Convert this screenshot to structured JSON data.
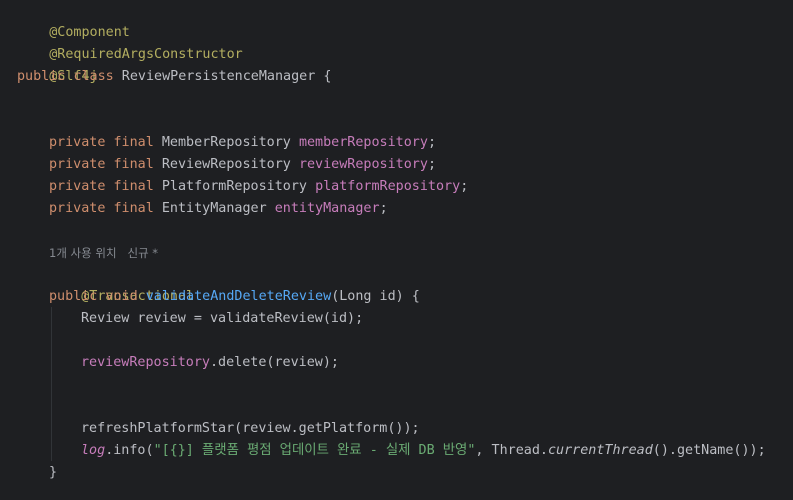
{
  "editor": {
    "annotations": {
      "component": "@Component",
      "required_args": "@RequiredArgsConstructor",
      "slf4j": "@Slf4j",
      "transactional": "@Transactional"
    },
    "class_decl": {
      "kw_public": "public",
      "kw_class": "class",
      "name": " ReviewPersistenceManager {"
    },
    "fields": [
      {
        "mods": "private final",
        "type": " MemberRepository ",
        "name": "memberRepository",
        "end": ";"
      },
      {
        "mods": "private final",
        "type": " ReviewRepository ",
        "name": "reviewRepository",
        "end": ";"
      },
      {
        "mods": "private final",
        "type": " PlatformRepository ",
        "name": "platformRepository",
        "end": ";"
      },
      {
        "mods": "private final",
        "type": " EntityManager ",
        "name": "entityManager",
        "end": ";"
      }
    ],
    "usage_hint": "1개 사용 위치   신규 *",
    "method": {
      "mods": "public void",
      "name": "validateAndDeleteReview",
      "params": "(Long id) {",
      "line1": "Review review = validateReview(id);",
      "line2_field": "reviewRepository",
      "line2_rest": ".delete(review);",
      "line3": "refreshPlatformStar(review.getPlatform());",
      "line4_log": "log",
      "line4_call": ".info(",
      "line4_string": "\"[{}] 플랫폼 평점 업데이트 완료 - 실제 DB 반영\"",
      "line4_mid": ", Thread.",
      "line4_italic": "currentThread",
      "line4_end": "().getName());",
      "close_brace": "}"
    }
  }
}
